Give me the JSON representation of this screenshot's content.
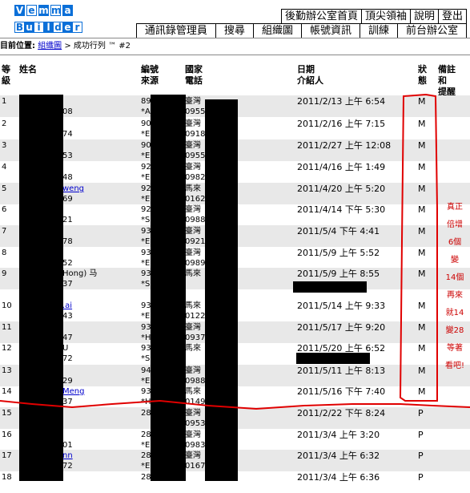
{
  "logo": {
    "row1": [
      "V",
      "e",
      "m",
      "m",
      "a"
    ],
    "row2": [
      "B",
      "u",
      "i",
      "l",
      "d",
      "e",
      "r"
    ]
  },
  "nav_top": [
    "後勤辦公室首頁",
    "頂尖領袖",
    "說明",
    "登出"
  ],
  "nav_bottom": [
    "通訊錄管理員",
    "搜尋",
    "組織圖",
    "帳號資訊",
    "訓練",
    "前台辦公室"
  ],
  "breadcrumb": {
    "prefix": "目前位置:",
    "link": "組織圖",
    "rest": "> 成功行列 ™ #2"
  },
  "columns": {
    "rank": [
      "等",
      "級"
    ],
    "name": "姓名",
    "num": [
      "編號",
      "來源"
    ],
    "phone": [
      "國家",
      "電話"
    ],
    "date": [
      "日期",
      "介紹人"
    ],
    "status": [
      "狀",
      "態"
    ],
    "note": [
      "備註",
      "和",
      "提醒"
    ]
  },
  "rows": [
    {
      "rank": "1",
      "name": "",
      "name2": "08",
      "num": "89",
      "num2": "*A",
      "ph": "臺灣",
      "ph2": "0955",
      "date": "2011/2/13 上午 6:54",
      "status": "M"
    },
    {
      "rank": "2",
      "name": "",
      "name2": "74",
      "num": "90",
      "num2": "*E",
      "ph": "臺灣",
      "ph2": "0918",
      "date": "2011/2/16 上午 7:15",
      "status": "M"
    },
    {
      "rank": "3",
      "name": "",
      "name2": "53",
      "num": "90",
      "num2": "*E",
      "ph": "臺灣",
      "ph2": "0955",
      "date": "2011/2/27 上午 12:08",
      "status": "M"
    },
    {
      "rank": "4",
      "name": "",
      "name2": "48",
      "num": "92",
      "num2": "*E",
      "ph": "臺灣",
      "ph2": "0982",
      "date": "2011/4/16 上午 1:49",
      "status": "M"
    },
    {
      "rank": "5",
      "name": "weng",
      "name2": "69",
      "num": "92",
      "num2": "*E",
      "ph": "馬來",
      "ph2": "0162",
      "date": "2011/4/20 上午 5:20",
      "status": "M",
      "link": true
    },
    {
      "rank": "6",
      "name": "",
      "name2": "21",
      "num": "92",
      "num2": "*S",
      "ph": "臺灣",
      "ph2": "0988",
      "date": "2011/4/14 下午 5:30",
      "status": "M"
    },
    {
      "rank": "7",
      "name": "",
      "name2": "78",
      "num": "93",
      "num2": "*E",
      "ph": "臺灣",
      "ph2": "0921",
      "date": "2011/5/4 下午 4:41",
      "status": "M"
    },
    {
      "rank": "8",
      "name": "",
      "name2": "52",
      "num": "93",
      "num2": "*E",
      "ph": "臺灣",
      "ph2": "0989",
      "date": "2011/5/9 上午 5:52",
      "status": "M"
    },
    {
      "rank": "9",
      "name": "Hong) 马",
      "name2": "37",
      "num": "93",
      "num2": "*S",
      "ph": "馬來",
      "ph2": "",
      "date": "2011/5/9 上午 8:55",
      "status": "M"
    },
    {
      "rank": "10",
      "name": ".ai",
      "name2": "43",
      "num": "93",
      "num2": "*E",
      "ph": "馬來",
      "ph2": "0122",
      "date": "2011/5/14 上午 9:33",
      "status": "M",
      "link": true
    },
    {
      "rank": "11",
      "name": "",
      "name2": "47",
      "num": "93",
      "num2": "*H",
      "ph": "臺灣",
      "ph2": "0937",
      "date": "2011/5/17 上午 9:20",
      "status": "M"
    },
    {
      "rank": "12",
      "name": "U",
      "name2": "72",
      "num": "93",
      "num2": "*S",
      "ph": "馬來",
      "ph2": "",
      "date": "2011/5/20 上午 6:52",
      "status": "M"
    },
    {
      "rank": "13",
      "name": "",
      "name2": "29",
      "num": "94",
      "num2": "*E",
      "ph": "臺灣",
      "ph2": "0988",
      "date": "2011/5/11 上午 8:13",
      "status": "M"
    },
    {
      "rank": "14",
      "name": "Meng",
      "name2": "37",
      "num": "93",
      "num2": "*H",
      "ph": "馬來",
      "ph2": "0149",
      "date": "2011/5/16 下午 7:40",
      "status": "M",
      "link": true
    },
    {
      "rank": "15",
      "name": "",
      "name2": "",
      "num": "28",
      "num2": "",
      "ph": "臺灣",
      "ph2": "0953",
      "date": "2011/2/22 下午 8:24",
      "status": "P"
    },
    {
      "rank": "16",
      "name": "",
      "name2": "01",
      "num": "28",
      "num2": "*E",
      "ph": "臺灣",
      "ph2": "0983",
      "date": "2011/3/4 上午 3:20",
      "status": "P"
    },
    {
      "rank": "17",
      "name": "nn",
      "name2": "72",
      "num": "28",
      "num2": "*E",
      "ph": "臺灣",
      "ph2": "0167",
      "date": "2011/3/4 上午 6:32",
      "status": "P",
      "link": true
    },
    {
      "rank": "18",
      "name": "",
      "name2": "",
      "num": "28",
      "num2": "",
      "ph": "",
      "ph2": "",
      "date": "2011/3/4 上午 6:36",
      "status": "P"
    }
  ],
  "annotation": [
    "真正",
    "倍增",
    "6個",
    "變",
    "14個",
    "再來",
    "就14",
    "變28",
    "等著",
    "看吧!"
  ],
  "annotation_color": "#cc0000",
  "logo_color": "#0a6fd8",
  "link_color": "#0000cc"
}
